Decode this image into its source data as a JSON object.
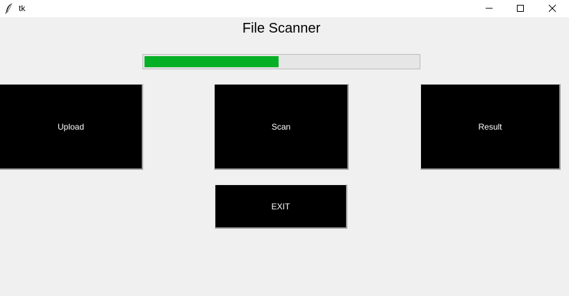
{
  "window": {
    "title": "tk",
    "icon": "feather-icon",
    "controls": [
      "minimize-icon",
      "maximize-icon",
      "close-icon"
    ]
  },
  "main": {
    "heading": "File Scanner",
    "progress": {
      "percent": 49,
      "fill_color": "#06b025",
      "track_color": "#e6e6e6"
    },
    "buttons": {
      "upload_label": "Upload",
      "scan_label": "Scan",
      "result_label": "Result",
      "exit_label": "EXIT"
    },
    "button_bg": "#000000",
    "button_fg": "#ffffff"
  }
}
